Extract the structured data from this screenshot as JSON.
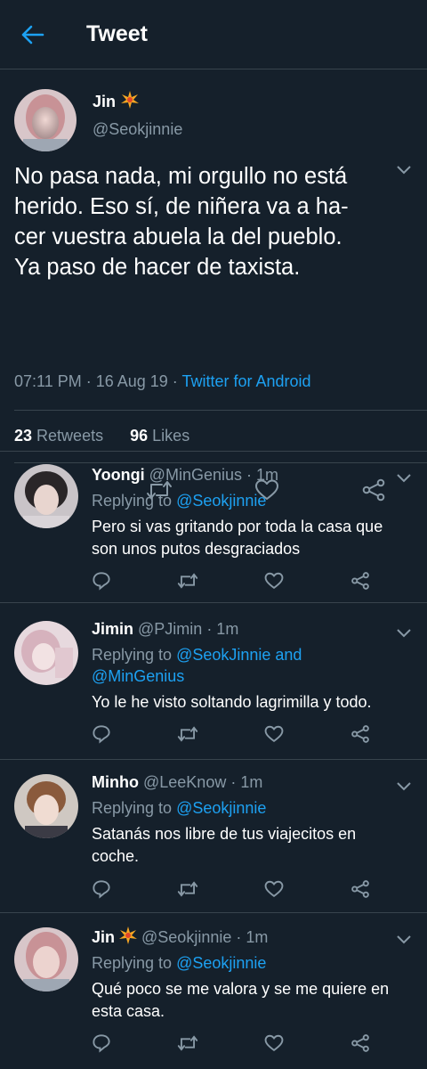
{
  "header": {
    "title": "Tweet",
    "back_icon": "arrow-left-icon",
    "accent": "#1da1f2"
  },
  "main_tweet": {
    "display_name": "Jin",
    "name_emoji": "sparkle-burst-icon",
    "handle": "@Seokjinnie",
    "text_lines": [
      "No pasa nada, mi orgullo no está",
      "herido. Eso sí, de niñera va a ha-",
      "cer vuestra abuela la del pueblo.",
      "Ya paso de hacer de taxista."
    ],
    "time": "07:11 PM · 16 Aug 19 · ",
    "source": "Twitter for Android",
    "retweets_count": "23",
    "retweets_label": "Retweets",
    "likes_count": "96",
    "likes_label": "Likes"
  },
  "replies": [
    {
      "display_name": "Yoongi",
      "handle_time": "@MinGenius · 1m",
      "replying_prefix": "Replying to ",
      "replying_lines": [
        "@Seokjinnie"
      ],
      "text_lines": [
        "Pero si vas gritando por toda la casa que",
        "son unos putos desgraciados"
      ]
    },
    {
      "display_name": "Jimin",
      "handle_time": "@PJimin · 1m",
      "replying_prefix": "Replying to ",
      "replying_lines": [
        "@SeokJinnie and",
        "@MinGenius"
      ],
      "text_lines": [
        "Yo le he visto soltando lagrimilla y todo."
      ]
    },
    {
      "display_name": "Minho",
      "handle_time": "@LeeKnow · 1m",
      "replying_prefix": "Replying to ",
      "replying_lines": [
        "@Seokjinnie"
      ],
      "text_lines": [
        "Satanás nos libre de tus viajecitos en",
        "coche."
      ]
    },
    {
      "display_name": "Jin",
      "name_emoji": "sparkle-burst-icon",
      "handle_time": "@Seokjinnie · 1m",
      "replying_prefix": "Replying to ",
      "replying_lines": [
        "@Seokjinnie"
      ],
      "text_lines": [
        "Qué poco se me valora y se me quiere en",
        "esta casa."
      ]
    }
  ],
  "action_icons": [
    "reply-icon",
    "retweet-icon",
    "like-icon",
    "share-icon"
  ],
  "colors": {
    "background": "#15202b",
    "secondary_text": "#8899a6",
    "divider": "#38444d",
    "link": "#1da1f2"
  }
}
